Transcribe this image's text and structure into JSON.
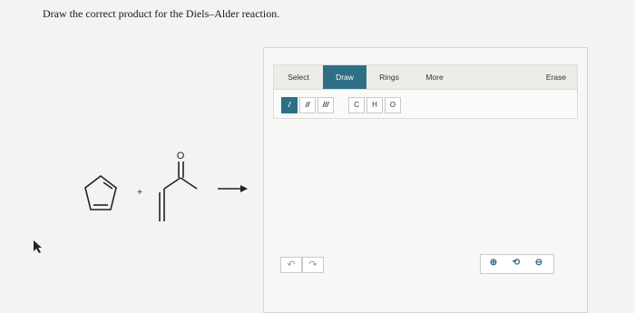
{
  "question": {
    "text": "Draw the correct product for the Diels–Alder reaction."
  },
  "reaction": {
    "plus_sign": "+",
    "oxygen_label": "O"
  },
  "editor": {
    "tabs": [
      {
        "label": "Select",
        "active": false
      },
      {
        "label": "Draw",
        "active": true
      },
      {
        "label": "Rings",
        "active": false
      },
      {
        "label": "More",
        "active": false
      },
      {
        "label": "Erase",
        "active": false
      }
    ],
    "bond_tools": [
      {
        "label": "/",
        "name": "single-bond",
        "active": true
      },
      {
        "label": "//",
        "name": "double-bond",
        "active": false
      },
      {
        "label": "///",
        "name": "triple-bond",
        "active": false
      }
    ],
    "atom_tools": [
      {
        "label": "C",
        "name": "carbon"
      },
      {
        "label": "H",
        "name": "hydrogen"
      },
      {
        "label": "O",
        "name": "oxygen"
      }
    ],
    "undo_symbol": "↶",
    "redo_symbol": "↷",
    "zoom_in_symbol": "⊕",
    "reset_symbol": "⟲",
    "zoom_out_symbol": "⊖"
  },
  "colors": {
    "accent": "#2f6f86",
    "background": "#f3f3f1"
  }
}
